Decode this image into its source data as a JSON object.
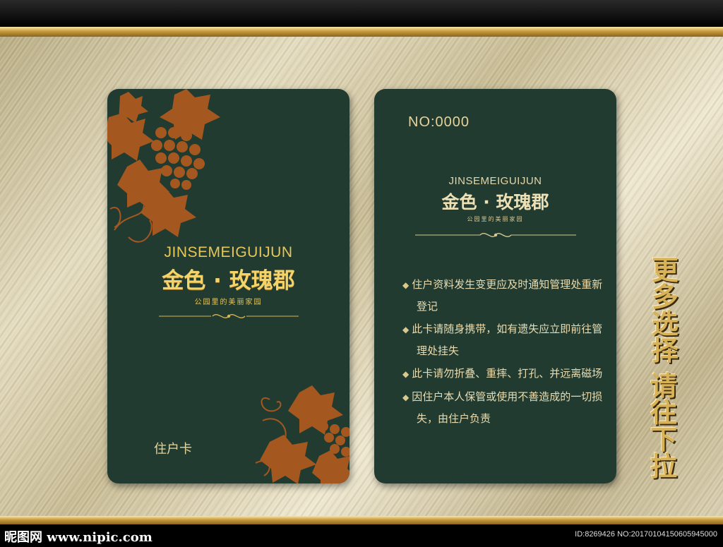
{
  "brand": {
    "latin": "JINSEMEIGUIJUN",
    "chinese": "金色 · 玫瑰郡",
    "slogan": "公园里的美丽家园"
  },
  "front_card": {
    "label": "住户卡"
  },
  "back_card": {
    "number": "NO:0000",
    "notes": [
      "住户资料发生变更应及时通知管理处重新登记",
      "此卡请随身携带，如有遗失应立即前往管理处挂失",
      "此卡请勿折叠、重摔、打孔、并远离磁场",
      "因住户本人保管或使用不善造成的一切损失，由住户负责"
    ]
  },
  "side_caption": {
    "line1": "更多选择",
    "line2": "请往下拉"
  },
  "footer": {
    "watermark": "昵图网 www.nipic.com",
    "id_text": "ID:8269426 NO:20170104150605945000"
  },
  "colors": {
    "card_green": "#223b31",
    "gold": "#e7c65a",
    "vine_copper": "#a4571f"
  }
}
